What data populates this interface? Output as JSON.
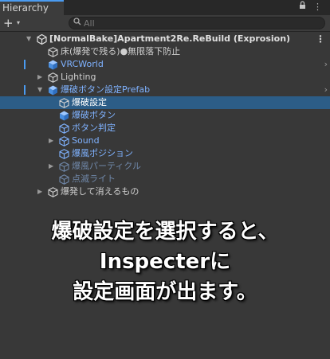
{
  "window": {
    "tab_label": "Hierarchy",
    "lock_icon": "lock-icon",
    "menu_icon": "kebab-menu-icon"
  },
  "toolbar": {
    "add_label": "+",
    "add_caret": "▾",
    "search_placeholder": "All"
  },
  "colors": {
    "selection": "#2c5d87",
    "prefab_blue": "#7fb2ff",
    "accent": "#4a9bf0"
  },
  "tree": [
    {
      "label": "[NormalBake]Apartment2Re.ReBuild (Exprosion)",
      "depth": 0,
      "arrow": "▼",
      "icon": "unity-scene-icon",
      "style": "scene",
      "menu": "⋮"
    },
    {
      "label": "床(爆発で残る)●無限落下防止",
      "depth": 1,
      "arrow": "",
      "icon": "gameobject-icon",
      "style": "plain"
    },
    {
      "label": "VRCWorld",
      "depth": 1,
      "arrow": "",
      "icon": "prefab-icon",
      "style": "blue",
      "chevron": "›",
      "marker": true
    },
    {
      "label": "Lighting",
      "depth": 1,
      "arrow": "▶",
      "icon": "gameobject-icon",
      "style": "plain"
    },
    {
      "label": "爆破ボタン設定Prefab",
      "depth": 1,
      "arrow": "▼",
      "icon": "prefab-icon",
      "style": "blue",
      "chevron": "›",
      "marker": true
    },
    {
      "label": "爆破設定",
      "depth": 2,
      "arrow": "",
      "icon": "gameobject-icon",
      "style": "plain",
      "selected": true
    },
    {
      "label": "爆破ボタン",
      "depth": 2,
      "arrow": "",
      "icon": "prefab-icon",
      "style": "blue"
    },
    {
      "label": "ボタン判定",
      "depth": 2,
      "arrow": "",
      "icon": "gameobject-icon",
      "style": "blue"
    },
    {
      "label": "Sound",
      "depth": 2,
      "arrow": "▶",
      "icon": "gameobject-icon",
      "style": "blue"
    },
    {
      "label": "爆風ポジション",
      "depth": 2,
      "arrow": "",
      "icon": "gameobject-icon",
      "style": "blue"
    },
    {
      "label": "爆風パーティクル",
      "depth": 2,
      "arrow": "▶",
      "icon": "gameobject-icon",
      "style": "dim"
    },
    {
      "label": "点滅ライト",
      "depth": 2,
      "arrow": "",
      "icon": "gameobject-icon",
      "style": "dim"
    },
    {
      "label": "爆発して消えるもの",
      "depth": 1,
      "arrow": "▶",
      "icon": "gameobject-icon",
      "style": "plain"
    }
  ],
  "overlay": {
    "line1": "爆破設定を選択すると、",
    "line2": "Inspecterに",
    "line3": "設定画面が出ます。"
  }
}
